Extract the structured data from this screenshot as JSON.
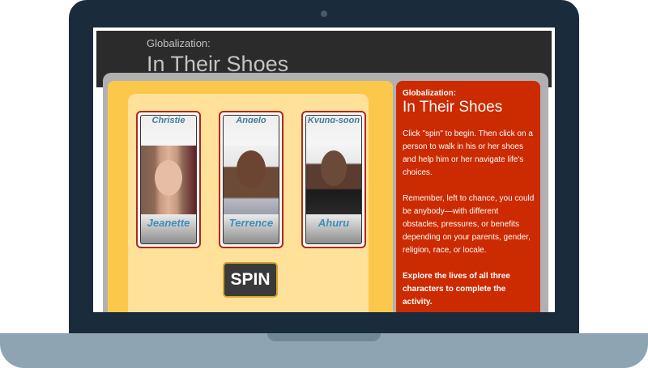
{
  "header": {
    "subtitle": "Globalization:",
    "title": "In Their Shoes"
  },
  "reels": [
    {
      "top_name": "Christie",
      "bottom_name": "Jeanette"
    },
    {
      "top_name": "Angelo",
      "bottom_name": "Terrence"
    },
    {
      "top_name": "Kyung-soon",
      "bottom_name": "Ahuru"
    }
  ],
  "spin_label": "SPIN",
  "info": {
    "subtitle": "Globalization:",
    "title": "In Their Shoes",
    "paragraph1": "Click \"spin\" to begin. Then click on a person to walk in his or her shoes and help him or her navigate life's choices.",
    "paragraph2": "Remember, left to chance, you could be anybody—with different obstacles, pressures, or benefits depending on your parents, gender, religion, race, or locale.",
    "paragraph3": "Explore the lives of all three characters to complete the activity."
  },
  "colors": {
    "laptop_frame": "#1a2b3b",
    "laptop_base": "#8ea4b2",
    "header_bg": "#2b2b2b",
    "slot_panel": "#fcc84b",
    "info_panel": "#cc2a00",
    "reel_border": "#b0281e",
    "name_text": "#3f8eb8"
  }
}
